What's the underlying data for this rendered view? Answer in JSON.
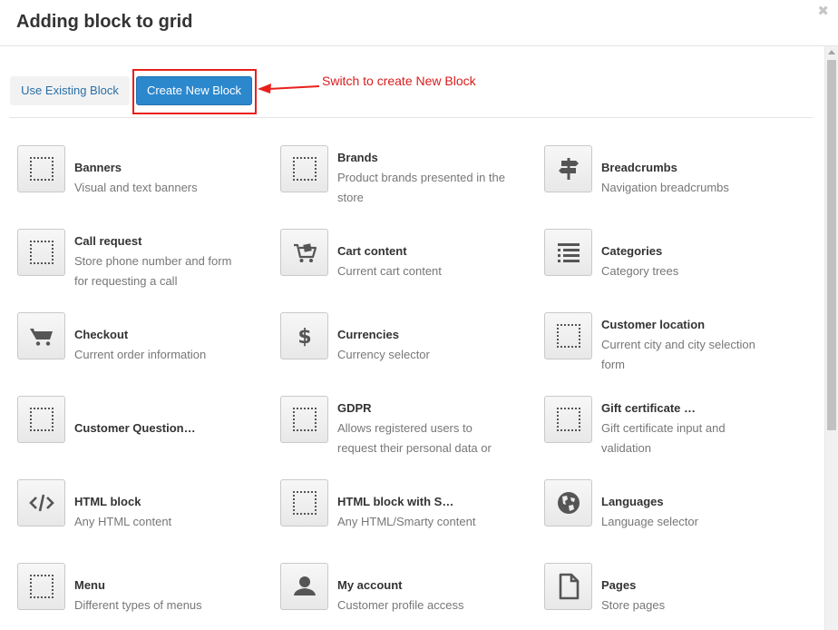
{
  "modal": {
    "title": "Adding block to grid"
  },
  "tabs": {
    "existing_label": "Use Existing Block",
    "create_label": "Create New Block"
  },
  "annotation": {
    "text": "Switch to create New Block",
    "color": "#d91c1c"
  },
  "colors": {
    "primary_button": "#2c88cc",
    "highlight": "#e8201c"
  },
  "blocks": [
    {
      "title": "Banners",
      "desc": "Visual and text banners",
      "icon": "dotted-square-icon"
    },
    {
      "title": "Brands",
      "desc": "Product brands presented in the store",
      "icon": "dotted-square-icon"
    },
    {
      "title": "Breadcrumbs",
      "desc": "Navigation breadcrumbs",
      "icon": "signpost-icon"
    },
    {
      "title": "Call request",
      "desc": "Store phone number and form for requesting a call",
      "icon": "dotted-square-icon"
    },
    {
      "title": "Cart content",
      "desc": "Current cart content",
      "icon": "cart-full-icon"
    },
    {
      "title": "Categories",
      "desc": "Category trees",
      "icon": "list-icon"
    },
    {
      "title": "Checkout",
      "desc": "Current order information",
      "icon": "cart-icon"
    },
    {
      "title": "Currencies",
      "desc": "Currency selector",
      "icon": "dollar-icon"
    },
    {
      "title": "Customer location",
      "desc": "Current city and city selection form",
      "icon": "dotted-square-icon"
    },
    {
      "title": "Customer Question…",
      "desc": "",
      "icon": "dotted-square-icon"
    },
    {
      "title": "GDPR",
      "desc": "Allows registered users to request their personal data or",
      "icon": "dotted-square-icon"
    },
    {
      "title": "Gift certificate …",
      "desc": "Gift certificate input and validation",
      "icon": "dotted-square-icon"
    },
    {
      "title": "HTML block",
      "desc": "Any HTML content",
      "icon": "code-icon"
    },
    {
      "title": "HTML block with S…",
      "desc": "Any HTML/Smarty content",
      "icon": "dotted-square-icon"
    },
    {
      "title": "Languages",
      "desc": "Language selector",
      "icon": "globe-icon"
    },
    {
      "title": "Menu",
      "desc": "Different types of menus",
      "icon": "dotted-square-icon"
    },
    {
      "title": "My account",
      "desc": "Customer profile access",
      "icon": "user-icon"
    },
    {
      "title": "Pages",
      "desc": "Store pages",
      "icon": "page-icon"
    }
  ]
}
